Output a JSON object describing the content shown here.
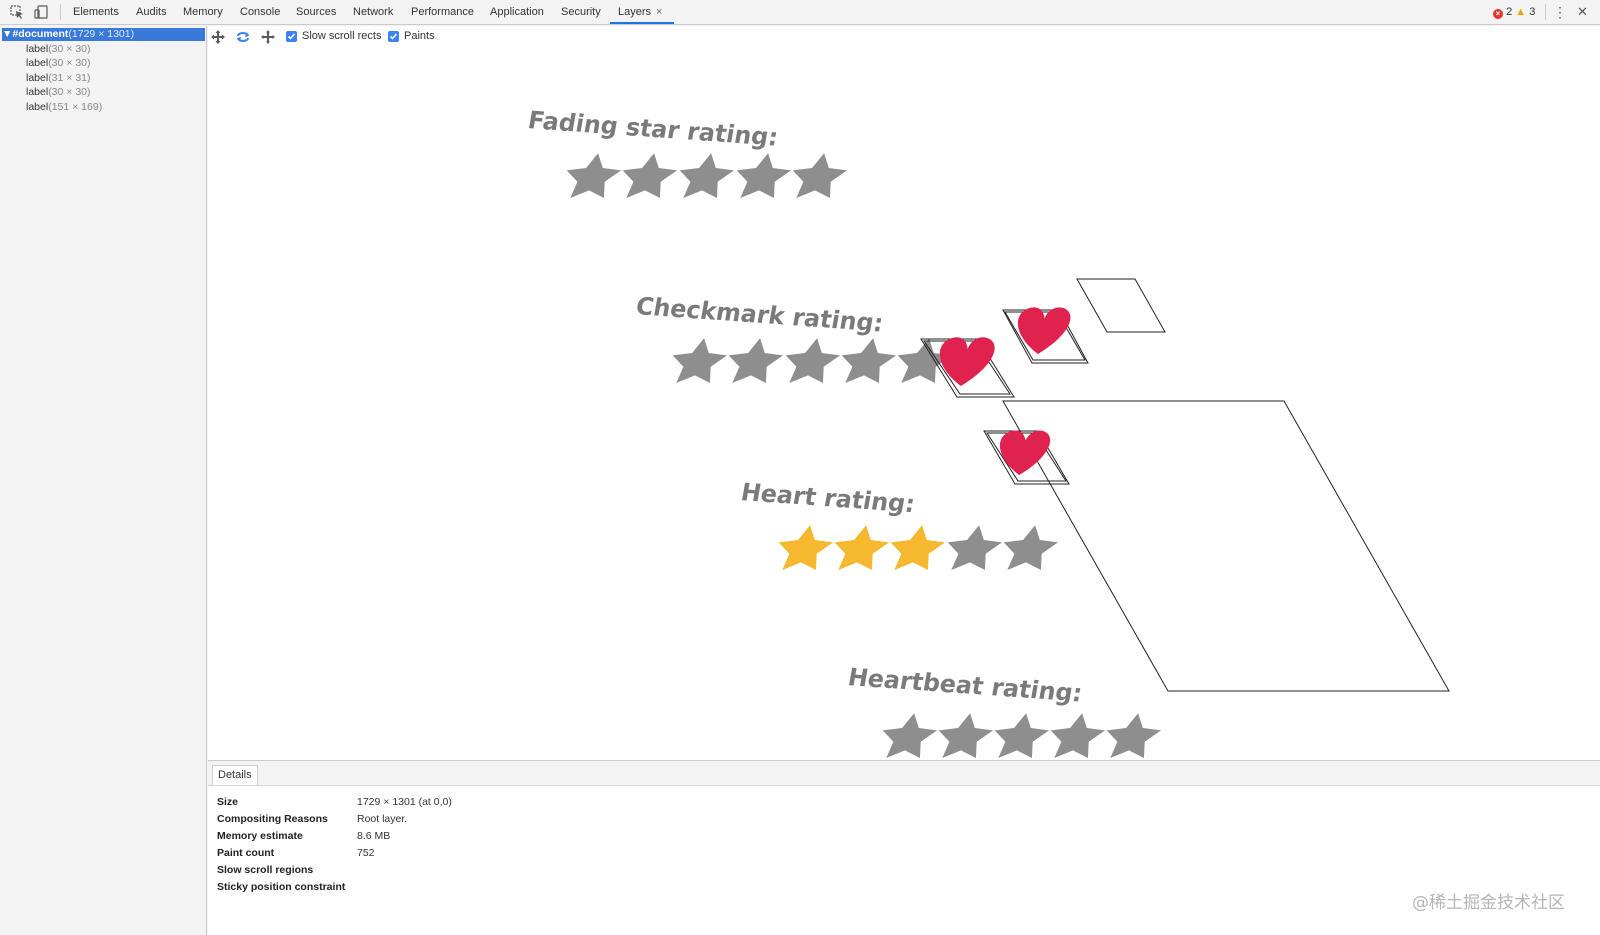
{
  "toolbar": {
    "tabs": [
      {
        "label": "Elements"
      },
      {
        "label": "Audits"
      },
      {
        "label": "Memory"
      },
      {
        "label": "Console"
      },
      {
        "label": "Sources"
      },
      {
        "label": "Network"
      },
      {
        "label": "Performance"
      },
      {
        "label": "Application"
      },
      {
        "label": "Security"
      },
      {
        "label": "Layers",
        "active": true
      }
    ],
    "close_glyph": "×",
    "errors": "2",
    "warnings": "3",
    "more_glyph": "⋮",
    "close_devtools_glyph": "✕",
    "icons": [
      "inspect-icon",
      "device-toggle-icon",
      "error-icon",
      "warning-icon",
      "more-icon",
      "close-icon"
    ]
  },
  "sidebar": {
    "root": {
      "arrow": "▼",
      "name": "#document",
      "size": "(1729 × 1301)"
    },
    "layers": [
      {
        "name": "label",
        "size": "(30 × 30)"
      },
      {
        "name": "label",
        "size": "(30 × 30)"
      },
      {
        "name": "label",
        "size": "(31 × 31)"
      },
      {
        "name": "label",
        "size": "(30 × 30)"
      },
      {
        "name": "label",
        "size": "(151 × 169)"
      }
    ]
  },
  "viewport_toolbar": {
    "icons": [
      "pan-icon",
      "rotate-icon",
      "reset-transform-icon"
    ],
    "slow_scroll_rects": {
      "label": "Slow scroll rects",
      "checked": true
    },
    "paints": {
      "label": "Paints",
      "checked": true
    }
  },
  "scene": {
    "headings": [
      "Fading star rating:",
      "Checkmark rating:",
      "Heart rating:",
      "Heartbeat rating:"
    ],
    "colors": {
      "star_grey": "#8e8e8e",
      "star_gold": "#f5b82e",
      "heart": "#e0234e",
      "heading": "#7a7a7a"
    }
  },
  "details": {
    "tab": "Details",
    "rows": [
      {
        "key": "Size",
        "value": "1729 × 1301 (at 0,0)"
      },
      {
        "key": "Compositing Reasons",
        "value": "Root layer."
      },
      {
        "key": "Memory estimate",
        "value": "8.6 MB"
      },
      {
        "key": "Paint count",
        "value": "752"
      },
      {
        "key": "Slow scroll regions",
        "value": ""
      },
      {
        "key": "Sticky position constraint",
        "value": ""
      }
    ]
  },
  "watermark": "@稀土掘金技术社区"
}
